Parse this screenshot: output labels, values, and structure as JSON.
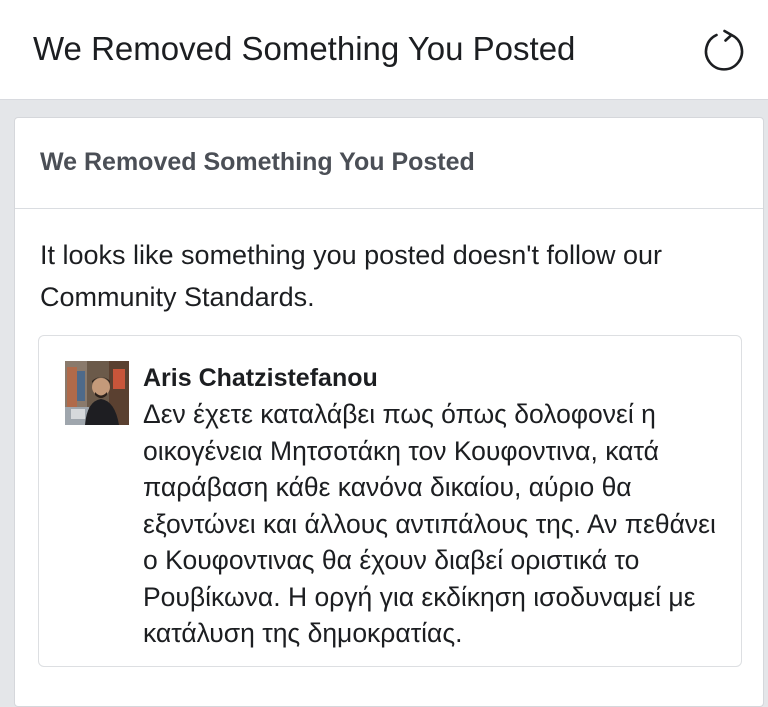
{
  "header": {
    "title": "We Removed Something You Posted",
    "refresh_icon": "refresh-icon"
  },
  "card": {
    "title": "We Removed Something You Posted",
    "message": "It looks like something you posted doesn't follow our Community Standards."
  },
  "post": {
    "author": "Aris Chatzistefanou",
    "avatar_icon": "user-photo",
    "text": "Δεν έχετε καταλάβει πως όπως δολοφονεί η οικογένεια Μητσοτάκη τον Κουφοντινα, κατά παράβαση κάθε κανόνα δικαίου, αύριο θα εξοντώνει και άλλους αντιπάλους της. Αν πεθάνει ο Κουφοντινας θα έχουν διαβεί οριστικά το Ρουβίκωνα. Η οργή για εκδίκηση ισοδυναμεί με κατάλυση της δημοκρατίας."
  },
  "colors": {
    "page_background": "#e4e6e9",
    "title_text": "#1c1e21",
    "card_title_text": "#4b4f56",
    "border": "#dadde1"
  }
}
